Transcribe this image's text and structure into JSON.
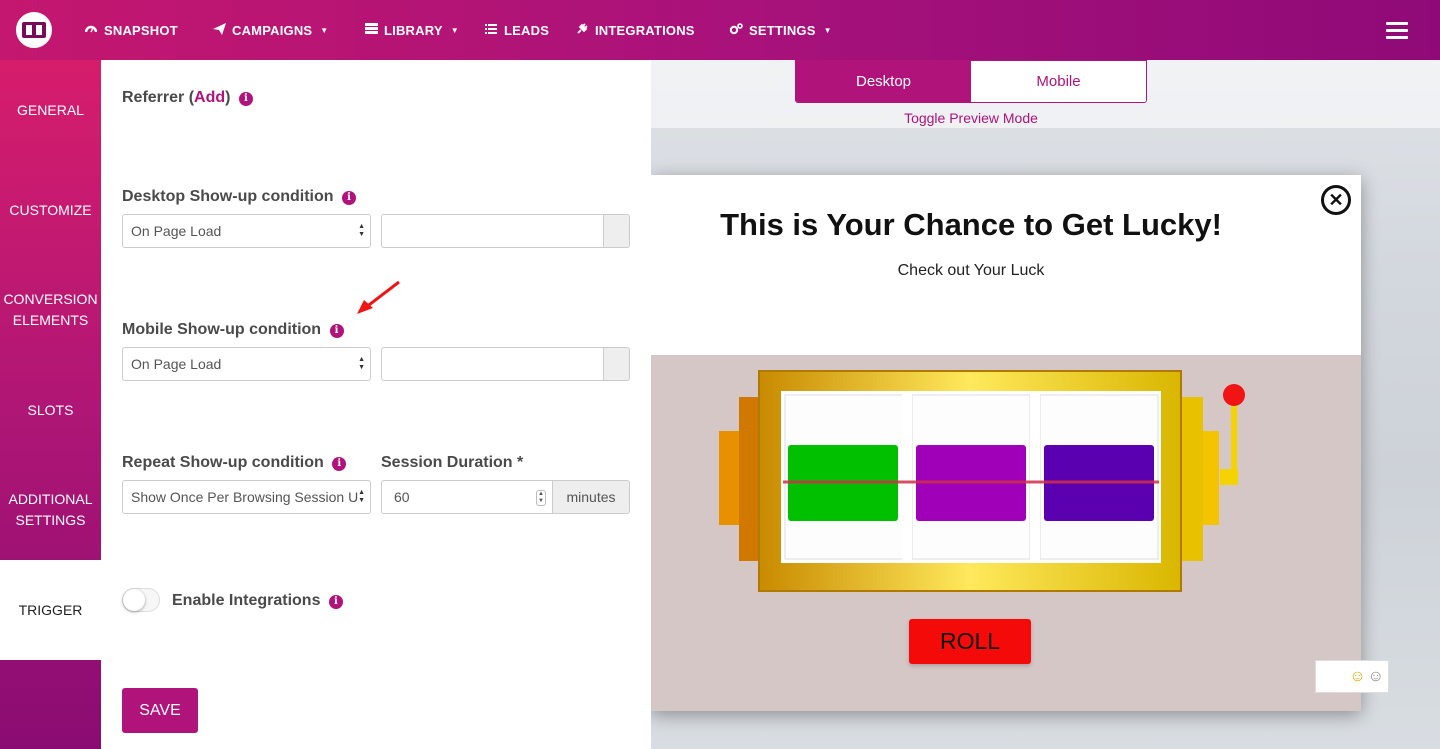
{
  "nav": {
    "items": [
      {
        "label": "SNAPSHOT",
        "icon": "dashboard-icon",
        "dropdown": false
      },
      {
        "label": "CAMPAIGNS",
        "icon": "paper-plane-icon",
        "dropdown": true
      },
      {
        "label": "LIBRARY",
        "icon": "library-icon",
        "dropdown": true
      },
      {
        "label": "LEADS",
        "icon": "list-icon",
        "dropdown": false
      },
      {
        "label": "INTEGRATIONS",
        "icon": "plug-icon",
        "dropdown": false
      },
      {
        "label": "SETTINGS",
        "icon": "gears-icon",
        "dropdown": true
      }
    ]
  },
  "sidetabs": {
    "items": [
      {
        "label": "GENERAL"
      },
      {
        "label": "CUSTOMIZE"
      },
      {
        "label": "CONVERSION ELEMENTS"
      },
      {
        "label": "SLOTS"
      },
      {
        "label": "ADDITIONAL SETTINGS"
      },
      {
        "label": "TRIGGER"
      }
    ],
    "active": "TRIGGER"
  },
  "form": {
    "referrer_label": "Referrer (",
    "referrer_add": "Add",
    "referrer_close": ")",
    "desktop_label": "Desktop Show-up condition",
    "desktop_value": "On Page Load",
    "mobile_label": "Mobile Show-up condition",
    "mobile_value": "On Page Load",
    "repeat_label": "Repeat Show-up condition",
    "repeat_value": "Show Once Per Browsing Session U",
    "session_label": "Session Duration *",
    "session_value": "60",
    "session_unit": "minutes",
    "integrations_label": "Enable Integrations",
    "save_label": "SAVE"
  },
  "preview": {
    "modes": [
      "Desktop",
      "Mobile"
    ],
    "active_mode": "Desktop",
    "toggle_link": "Toggle Preview Mode",
    "popup_title": "This is Your Chance to Get Lucky!",
    "popup_subtitle": "Check out Your Luck",
    "roll_label": "ROLL",
    "reel_colors": [
      "#00c000",
      "#a000b8",
      "#5a00b0"
    ]
  },
  "colors": {
    "brand": "#b0137a",
    "roll": "#f50a0a",
    "gold": "#e6c200"
  }
}
